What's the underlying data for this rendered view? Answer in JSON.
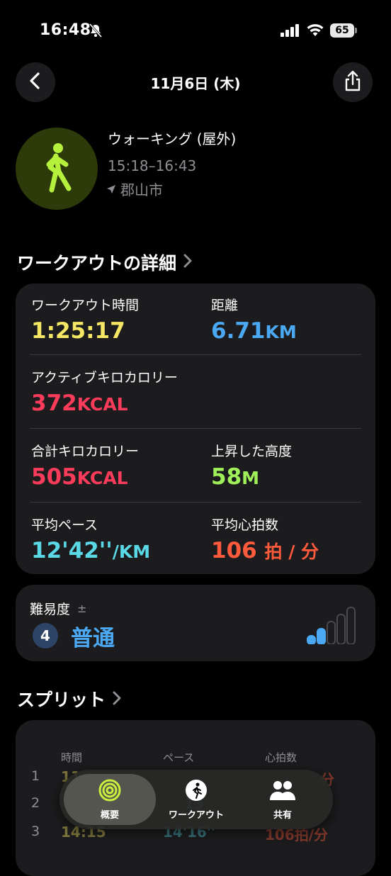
{
  "status": {
    "time": "16:48",
    "battery": "65"
  },
  "nav": {
    "title": "11月6日 (木)"
  },
  "workout": {
    "name": "ウォーキング (屋外)",
    "time_range": "15:18–16:43",
    "location": "郡山市"
  },
  "details": {
    "section_title": "ワークアウトの詳細",
    "duration": {
      "label": "ワークアウト時間",
      "value": "1:25:17",
      "color": "#f5e663"
    },
    "distance": {
      "label": "距離",
      "value": "6.71",
      "unit": "KM",
      "color": "#4ba8f2"
    },
    "active_kcal": {
      "label": "アクティブキロカロリー",
      "value": "372",
      "unit": "KCAL",
      "color": "#fa3c5a"
    },
    "total_kcal": {
      "label": "合計キロカロリー",
      "value": "505",
      "unit": "KCAL",
      "color": "#fa3c5a"
    },
    "elevation": {
      "label": "上昇した高度",
      "value": "58",
      "unit": "M",
      "color": "#a0f05a"
    },
    "avg_pace": {
      "label": "平均ペース",
      "value": "12'42''",
      "unit": "/KM",
      "color": "#5ad8e6"
    },
    "avg_hr": {
      "label": "平均心拍数",
      "value": "106",
      "unit": "拍 / 分",
      "color": "#ff5a3c"
    }
  },
  "difficulty": {
    "label": "難易度",
    "symbol": "±",
    "number": "4",
    "text": "普通",
    "level": 0.4
  },
  "splits": {
    "section_title": "スプリット",
    "headers": [
      "時間",
      "ペース",
      "心拍数"
    ],
    "rows": [
      {
        "idx": "1",
        "time": "11",
        "pace": "",
        "hr": "分"
      },
      {
        "idx": "2",
        "time": "",
        "pace": "13",
        "hr": ""
      },
      {
        "idx": "3",
        "time": "14:15",
        "pace": "14'16''",
        "hr": "106拍/分"
      }
    ]
  },
  "tabbar": {
    "tabs": [
      {
        "label": "概要",
        "icon": "activity-rings-icon"
      },
      {
        "label": "ワークアウト",
        "icon": "runner-icon"
      },
      {
        "label": "共有",
        "icon": "people-icon"
      }
    ]
  }
}
